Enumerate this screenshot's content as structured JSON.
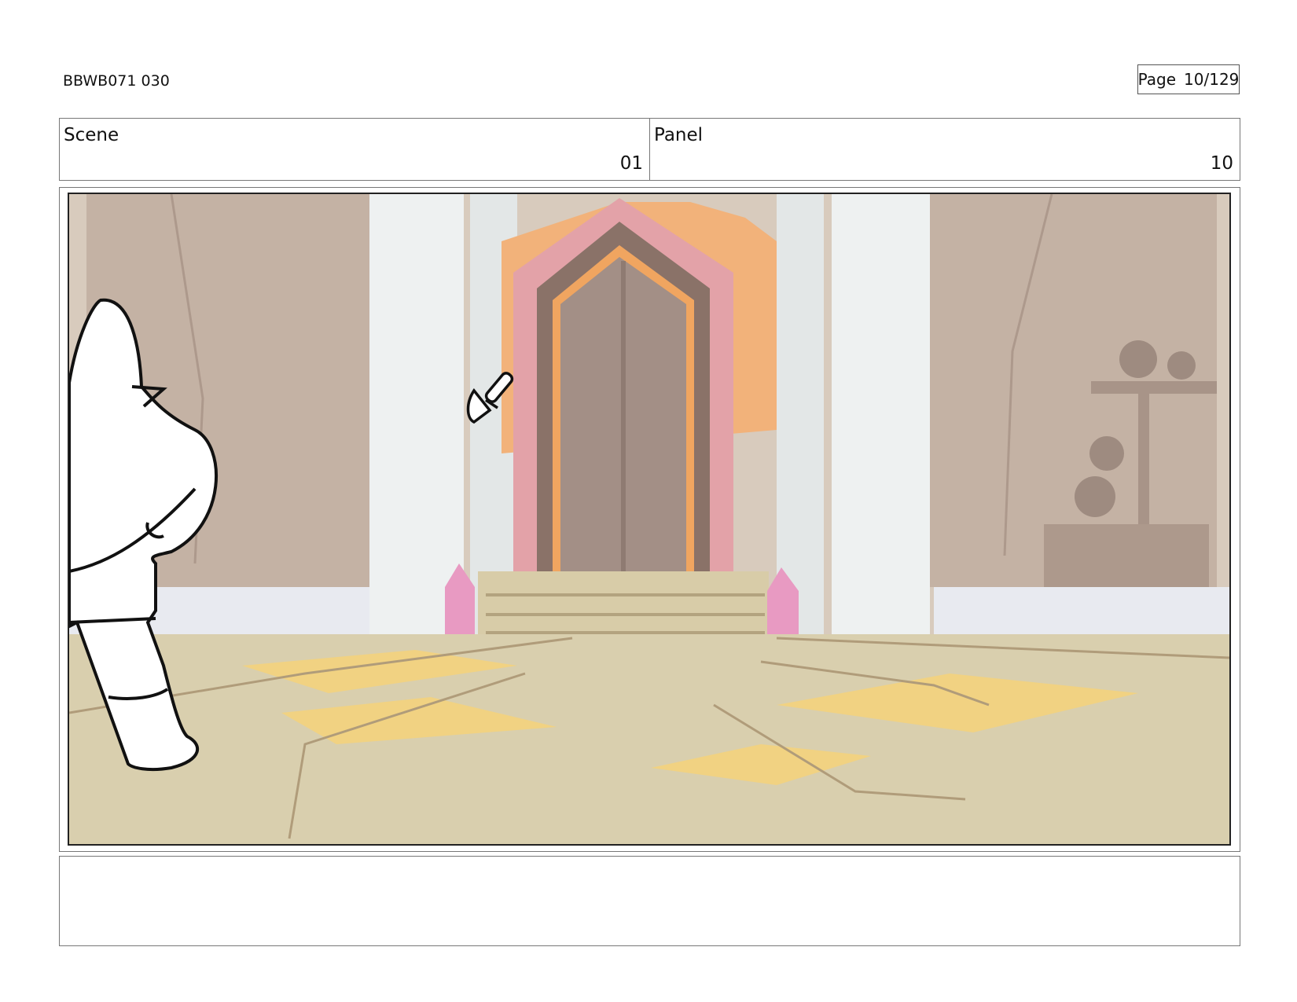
{
  "document": {
    "production_id": "BBWB071 030",
    "page": {
      "label": "Page",
      "value": "10/129"
    }
  },
  "header": {
    "scene": {
      "label": "Scene",
      "value": "01"
    },
    "panel": {
      "label": "Panel",
      "value": "10"
    }
  },
  "colors": {
    "wall": "#c9b8aa",
    "pillar": "#e8ecec",
    "floor": "#d9cfae",
    "floor_highlight": "#f4d27a",
    "door_arch": "#e7a0a8",
    "door_trim": "#f0a560",
    "door": "#a38f86",
    "crystal": "#e89ac2"
  },
  "notes": ""
}
